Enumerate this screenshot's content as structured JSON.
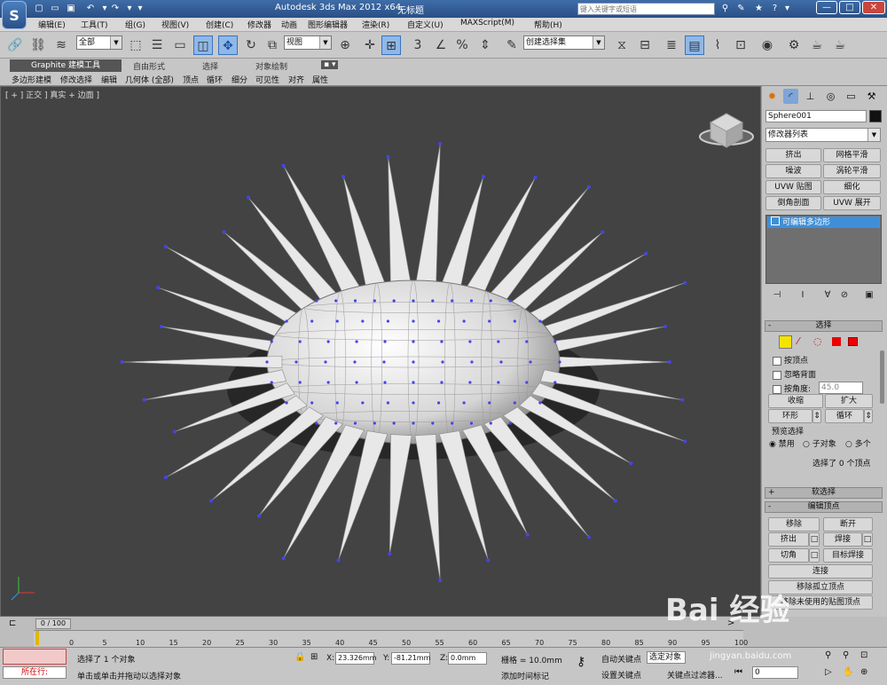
{
  "titlebar": {
    "app_title": "Autodesk 3ds Max  2012 x64",
    "doc_title": "无标题",
    "search_placeholder": "键入关键字或短语",
    "min_label": "—",
    "max_label": "□",
    "close_label": "✕"
  },
  "menubar": {
    "items": [
      "编辑(E)",
      "工具(T)",
      "组(G)",
      "视图(V)",
      "创建(C)",
      "修改器",
      "动画",
      "图形编辑器",
      "渲染(R)",
      "自定义(U)",
      "MAXScript(M)",
      "帮助(H)"
    ]
  },
  "maintoolbar": {
    "selection_filter": "全部",
    "ref_coord": "视图",
    "named_selection": "创建选择集"
  },
  "ribbon": {
    "tabs": [
      "Graphite 建模工具",
      "自由形式",
      "选择",
      "对象绘制"
    ],
    "sub_items": [
      "多边形建模",
      "修改选择",
      "编辑",
      "几何体 (全部)",
      "顶点",
      "循环",
      "细分",
      "可见性",
      "对齐",
      "属性"
    ]
  },
  "viewport": {
    "label": "[ + ] 正交 ] 真实 + 边面 ]"
  },
  "command_panel": {
    "object_name": "Sphere001",
    "modifier_list": "修改器列表",
    "modifier_buttons": [
      "挤出",
      "网格平滑",
      "噪波",
      "涡轮平滑",
      "UVW 贴图",
      "细化",
      "倒角剖面",
      "UVW 展开"
    ],
    "stack_item": "可编辑多边形",
    "selection_rollout": {
      "title": "选择",
      "by_vertex": "按顶点",
      "ignore_backfacing": "忽略背面",
      "by_angle": "按角度:",
      "angle_value": "45.0",
      "shrink": "收缩",
      "grow": "扩大",
      "ring": "环形",
      "loop": "循环",
      "preview_title": "预览选择",
      "preview_disabled": "禁用",
      "preview_subobject": "子对象",
      "preview_multi": "多个",
      "status": "选择了 0 个顶点"
    },
    "soft_selection": "软选择",
    "edit_vertices": {
      "title": "编辑顶点",
      "remove": "移除",
      "break": "断开",
      "extrude": "挤出",
      "weld": "焊接",
      "chamfer": "切角",
      "target_weld": "目标焊接",
      "connect": "连接",
      "remove_isolated": "移除孤立顶点",
      "remove_unused": "移除未使用的贴图顶点"
    }
  },
  "timeline": {
    "frame": "0 / 100",
    "ticks": [
      "0",
      "5",
      "10",
      "15",
      "20",
      "25",
      "30",
      "35",
      "40",
      "45",
      "50",
      "55",
      "60",
      "65",
      "70",
      "75",
      "80",
      "85",
      "90",
      "95",
      "100"
    ]
  },
  "status": {
    "selected": "选择了 1 个对象",
    "hint": "单击或单击并拖动以选择对象",
    "running": "所在行:",
    "x_label": "X:",
    "x_value": "23.326mm",
    "y_label": "Y:",
    "y_value": "-81.21mm",
    "z_label": "Z:",
    "z_value": "0.0mm",
    "grid": "栅格 = 10.0mm",
    "add_time_tag": "添加时间标记",
    "auto_key": "自动关键点",
    "set_key": "设置关键点",
    "selected_obj": "选定对象",
    "key_filters": "关键点过滤器...",
    "frame_field": "0"
  },
  "watermark": {
    "logo": "Bai 经验",
    "url": "jingyan.baidu.com"
  },
  "colors": {
    "title_blue": "#2f5a94",
    "viewport_bg": "#434343",
    "vertex_blue": "#4444ee",
    "stack_highlight": "#3f8fd8",
    "selection_yellow": "#f5e400"
  }
}
